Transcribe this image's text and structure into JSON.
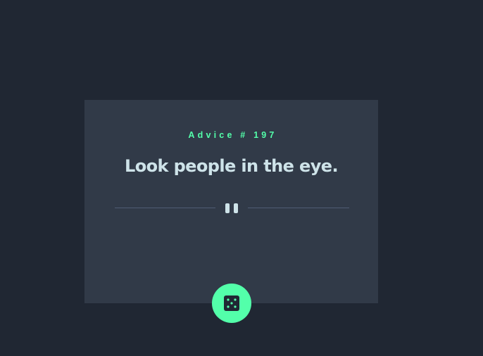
{
  "advice": {
    "label": "Advice # 197",
    "text": "Look people in the eye."
  },
  "colors": {
    "background": "#202733",
    "card": "#313A48",
    "accent": "#53FFAA",
    "text": "#CEE3E9",
    "divider": "#4F5D74"
  },
  "icons": {
    "divider": "pause-icon",
    "button": "dice-icon"
  }
}
